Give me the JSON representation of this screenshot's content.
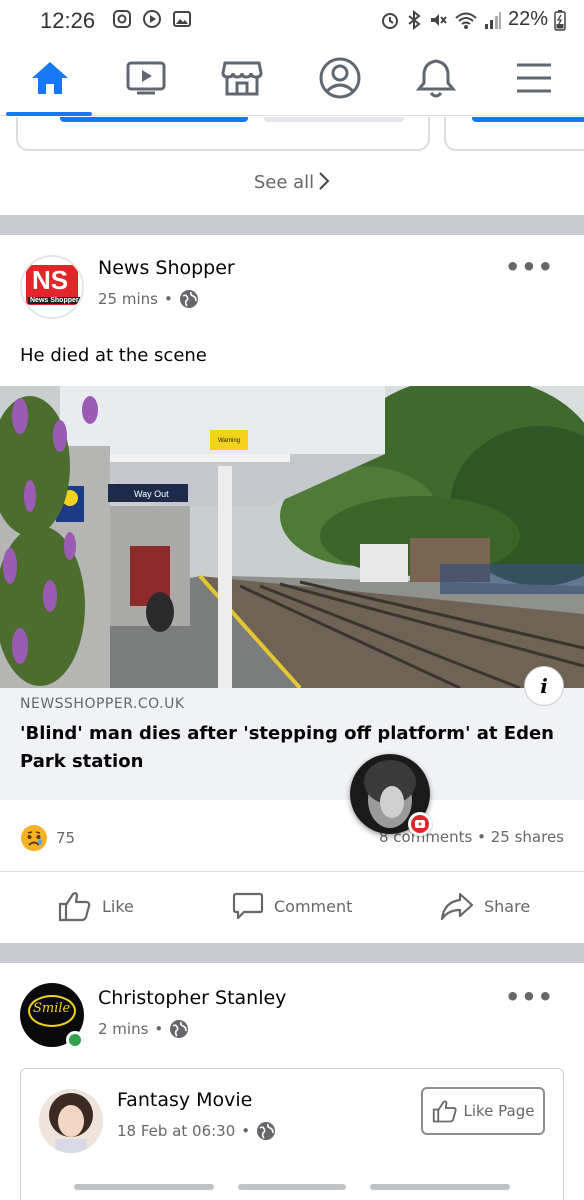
{
  "status_bar": {
    "time": "12:26",
    "battery": "22%"
  },
  "nav": {
    "items": [
      {
        "icon": "home-icon",
        "active": true
      },
      {
        "icon": "watch-icon",
        "active": false
      },
      {
        "icon": "marketplace-icon",
        "active": false
      },
      {
        "icon": "profile-icon",
        "active": false
      },
      {
        "icon": "notifications-icon",
        "active": false
      },
      {
        "icon": "menu-icon",
        "active": false
      }
    ],
    "accent": "#1877f2"
  },
  "prev_section": {
    "see_all": "See all"
  },
  "post1": {
    "author": "News Shopper",
    "avatar_text": "NS",
    "avatar_sub": "News Shopper",
    "time": "25 mins",
    "privacy_icon": "globe-icon",
    "text": "He died at the scene",
    "link": {
      "sign_warning": "Warning",
      "sign_way_out": "Way Out",
      "domain": "NEWSSHOPPER.CO.UK",
      "title": "'Blind' man dies after 'stepping off platform' at Eden Park station"
    },
    "reaction_icon": "sad-face-icon",
    "reaction_count": "75",
    "engagement": "8 comments • 25 shares",
    "actions": {
      "like": "Like",
      "comment": "Comment",
      "share": "Share"
    }
  },
  "post2": {
    "author": "Christopher Stanley",
    "avatar_text": "Smile",
    "time": "2 mins",
    "privacy_icon": "globe-icon",
    "shared": {
      "page_name": "Fantasy Movie",
      "date": "18 Feb at 06:30",
      "like_page_label": "Like Page"
    }
  }
}
